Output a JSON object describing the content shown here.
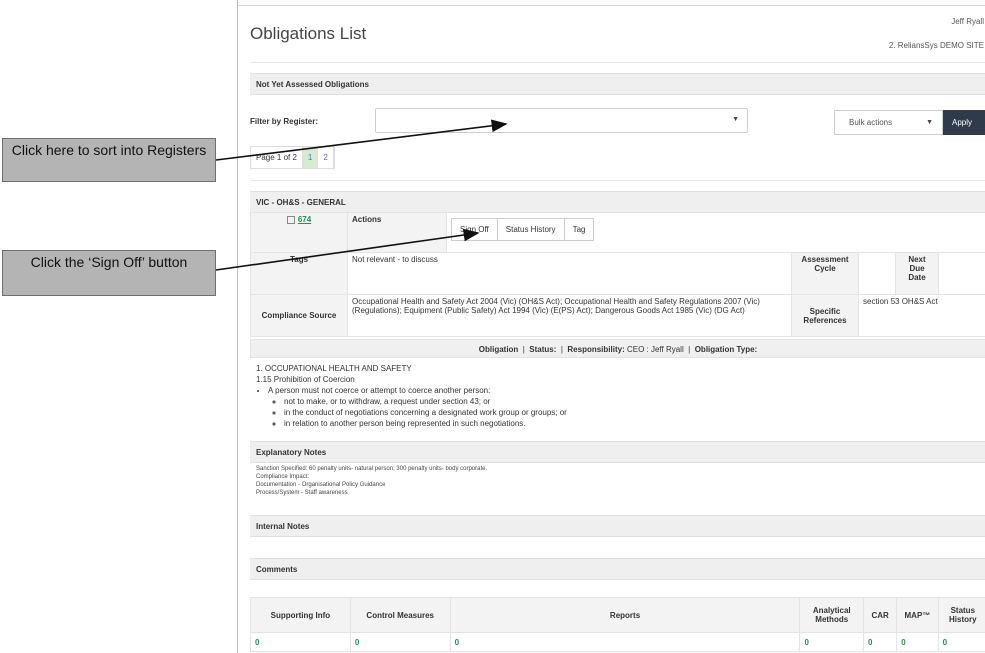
{
  "header": {
    "title": "Obligations List",
    "user": "Jeff Ryall",
    "site": "2. ReliansSys DEMO SITE"
  },
  "section": {
    "title": "Not Yet Assessed Obligations"
  },
  "filter": {
    "label": "Filter by Register:",
    "value": "",
    "bulk_label": "Bulk actions",
    "apply_label": "Apply"
  },
  "pager": {
    "info": "Page 1 of 2",
    "pages": [
      "1",
      "2"
    ]
  },
  "group": {
    "title": "VIC - OH&S - GENERAL"
  },
  "record": {
    "id": "674",
    "actions_label": "Actions",
    "tabs": [
      "Sign Off",
      "Status History",
      "Tag"
    ],
    "tags_label": "Tags",
    "tags_value": "Not relevant - to discuss",
    "assessment_cycle_label": "Assessment Cycle",
    "next_due_label": "Next Due Date",
    "source_label": "Compliance Source",
    "source_value": "Occupational Health and Safety Act 2004 (Vic) (OH&S Act); Occupational Health and Safety Regulations 2007 (Vic) (Regulations); Equipment (Public Safety) Act 1994 (Vic) (E(PS) Act); Dangerous Goods Act 1985 (Vic) (DG Act)",
    "specific_label": "Specific References",
    "specific_value": "section 53 OH&S Act"
  },
  "obligation_bar": {
    "obligation": "Obligation",
    "status": "Status:",
    "responsibility_label": "Responsibility:",
    "responsibility_value": "CEO : Jeff Ryall",
    "type_label": "Obligation Type:"
  },
  "obligation": {
    "heading1": "1. OCCUPATIONAL HEALTH AND SAFETY",
    "heading2": "1.15 Prohibition of Coercion",
    "bullet": "A person must not coerce or attempt to coerce another person:",
    "subs": [
      "not to make, or to withdraw, a request under section 43; or",
      "in the conduct of negotiations concerning a designated work group or groups; or",
      "in relation to another person being represented in such negotiations."
    ]
  },
  "explanatory": {
    "title": "Explanatory Notes",
    "lines": [
      "Sanction Specified: 60 penalty units- natural person; 300 penalty units- body corporate.",
      "Compliance Impact:",
      "Documentation - Organisational Policy Guidance",
      "Process/System - Staff awareness"
    ]
  },
  "internal": {
    "title": "Internal Notes"
  },
  "comments": {
    "title": "Comments"
  },
  "bottom": {
    "headers": [
      "Supporting Info",
      "Control Measures",
      "Reports",
      "Analytical Methods",
      "CAR",
      "MAP™",
      "Status History"
    ],
    "values": [
      "0",
      "0",
      "0",
      "0",
      "0",
      "0",
      "0"
    ]
  },
  "callouts": {
    "sort": "Click here to sort into Registers",
    "signoff": "Click the ‘Sign Off’ button"
  },
  "colors": {
    "apply_bg": "#2f3b4a",
    "link": "#2e8b57",
    "callout_bg": "#b4b4b4"
  }
}
